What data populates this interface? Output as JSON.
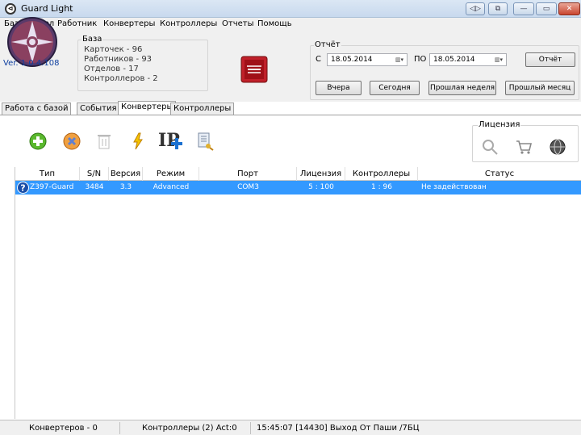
{
  "window": {
    "title": "Guard Light"
  },
  "menu": [
    "База",
    "Отдел",
    "Работник",
    "Конвертеры",
    "Контроллеры",
    "Отчеты",
    "Помощь"
  ],
  "version": "Ver. 1.0.4.108",
  "db": {
    "caption": "База",
    "cards": "Карточек - 96",
    "workers": "Работников - 93",
    "depts": "Отделов - 17",
    "controllers": "Контроллеров - 2"
  },
  "report": {
    "caption": "Отчёт",
    "from_label": "С",
    "from_date": "18.05.2014",
    "to_label": "ПО",
    "to_date": "18.05.2014",
    "report_btn": "Отчёт",
    "yesterday_btn": "Вчера",
    "today_btn": "Сегодня",
    "last_week_btn": "Прошлая неделя",
    "last_month_btn": "Прошлый месяц"
  },
  "tabs": [
    "Работа с базой",
    "События",
    "Конвертеры",
    "Контроллеры"
  ],
  "active_tab": 2,
  "toolbar": {
    "ip_label": "IP"
  },
  "license": {
    "caption": "Лицензия"
  },
  "table": {
    "columns": [
      "Тип",
      "S/N",
      "Версия",
      "Режим",
      "Порт",
      "Лицензия",
      "Контроллеры",
      "Статус"
    ],
    "rows": [
      [
        "Z397-Guard",
        "3484",
        "3.3",
        "Advanced",
        "COM3",
        "5 : 100",
        "1 : 96",
        "Не задействован"
      ]
    ]
  },
  "status": {
    "converters": "Конвертеров - 0",
    "controllers": "Контроллеры (2) Act:0",
    "event": "15:45:07 [14430] Выход От Паши  /7БЦ"
  },
  "colors": {
    "selection": "#3399ff",
    "accent_logo": "#c03050"
  }
}
